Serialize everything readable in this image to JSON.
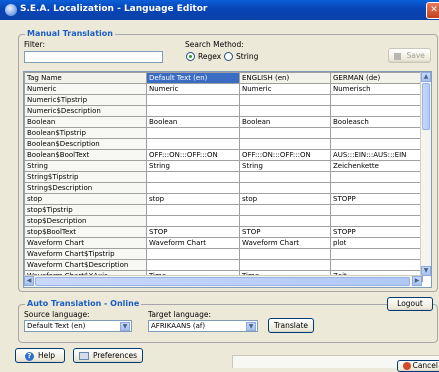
{
  "window": {
    "title": "S.E.A. Localization - Language Editor"
  },
  "manual": {
    "legend": "Manual Translation",
    "filter_label": "Filter:",
    "filter_value": "",
    "search_method_label": "Search Method:",
    "search_methods": [
      "Regex",
      "String"
    ],
    "selected_method": "Regex",
    "save_label": "Save"
  },
  "table": {
    "columns": [
      "Tag Name",
      "Default Text (en)",
      "ENGLISH (en)",
      "GERMAN (de)"
    ],
    "selected_column": "Default Text (en)",
    "rows": [
      [
        "Numeric",
        "Numeric",
        "Numeric",
        "Numerisch"
      ],
      [
        "Numeric$Tipstrip",
        "",
        "",
        ""
      ],
      [
        "Numeric$Description",
        "",
        "",
        ""
      ],
      [
        "Boolean",
        "Boolean",
        "Boolean",
        "Booleasch"
      ],
      [
        "Boolean$Tipstrip",
        "",
        "",
        ""
      ],
      [
        "Boolean$Description",
        "",
        "",
        ""
      ],
      [
        "Boolean$BoolText",
        "OFF:::ON:::OFF:::ON",
        "OFF:::ON:::OFF:::ON",
        "AUS:::EIN:::AUS:::EIN"
      ],
      [
        "String",
        "String",
        "String",
        "Zeichenkette"
      ],
      [
        "String$Tipstrip",
        "",
        "",
        ""
      ],
      [
        "String$Description",
        "",
        "",
        ""
      ],
      [
        "stop",
        "stop",
        "stop",
        "STOPP"
      ],
      [
        "stop$Tipstrip",
        "",
        "",
        ""
      ],
      [
        "stop$Description",
        "",
        "",
        ""
      ],
      [
        "stop$BoolText",
        "STOP",
        "STOP",
        "STOPP"
      ],
      [
        "Waveform Chart",
        "Waveform Chart",
        "Waveform Chart",
        "plot"
      ],
      [
        "Waveform Chart$Tipstrip",
        "",
        "",
        ""
      ],
      [
        "Waveform Chart$Description",
        "",
        "",
        ""
      ],
      [
        "Waveform Chart$XAxis",
        "Time",
        "Time",
        "Zeit"
      ]
    ]
  },
  "auto": {
    "legend": "Auto Translation - Online",
    "logout_label": "Logout",
    "source_label": "Source language:",
    "source_value": "Default Text (en)",
    "target_label": "Target language:",
    "target_value": "AFRIKAANS (af)",
    "translate_label": "Translate"
  },
  "footer": {
    "help_label": "Help",
    "preferences_label": "Preferences",
    "cancel_label": "Cancel"
  }
}
